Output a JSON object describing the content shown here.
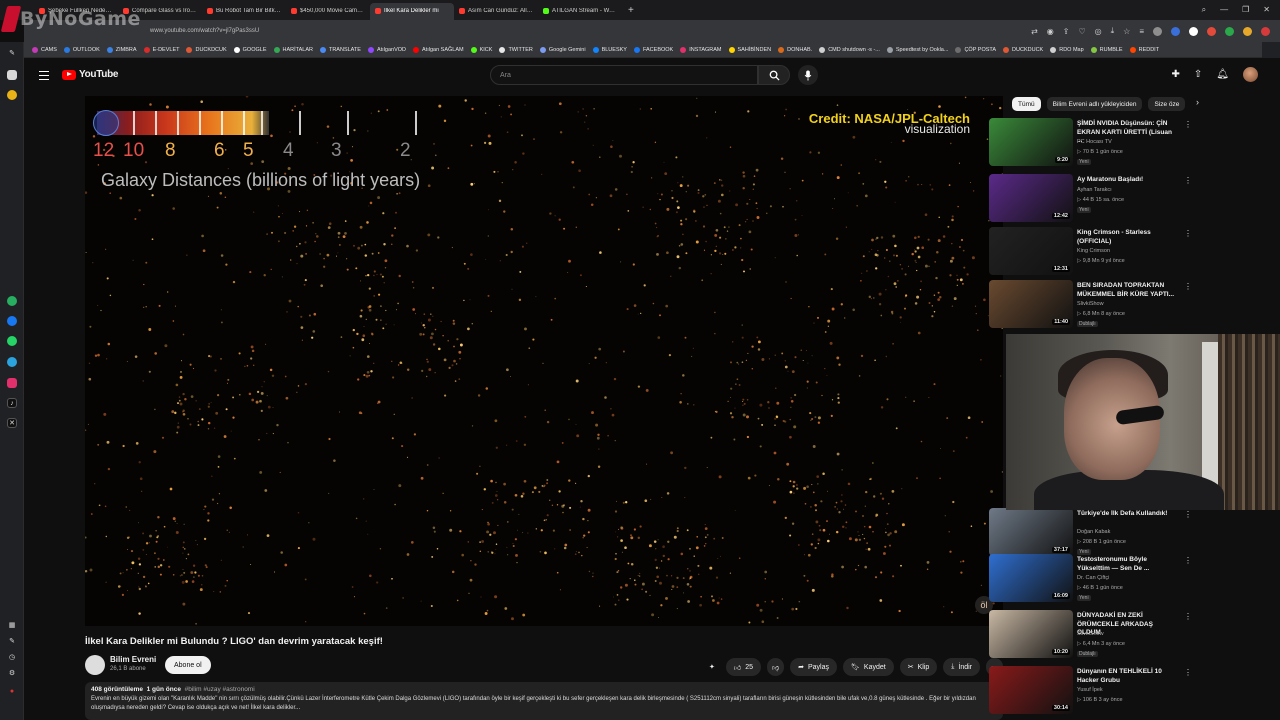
{
  "brand": {
    "overlay_text": "ByNoGame"
  },
  "browser": {
    "tabs": [
      {
        "title": "Şebeke Fullken Neden İnti",
        "active": false,
        "color": "#ff3b30"
      },
      {
        "title": "Compare Glass vs Iron - Y",
        "active": false,
        "color": "#ff3b30"
      },
      {
        "title": "Bu Robot Tam Bir Bitki Gi",
        "active": false,
        "color": "#ff3b30"
      },
      {
        "title": "$450,000 Movie Camera",
        "active": false,
        "color": "#ff3b30"
      },
      {
        "title": "İlkel Kara Delikler mi",
        "active": true,
        "color": "#ff3b30"
      },
      {
        "title": "Asım Can Gündüz: Allaşı",
        "active": false,
        "color": "#ff3b30"
      },
      {
        "title": "ATILGAN Stream - Watch",
        "active": false,
        "color": "#53fc18"
      }
    ],
    "new_tab": "+",
    "url": "www.youtube.com/watch?v=jl7gPas3ssU",
    "bookmarks": [
      {
        "label": "CAMS",
        "color": "#c53ab5"
      },
      {
        "label": "OUTLOOK",
        "color": "#2a7ae2"
      },
      {
        "label": "ZIMBRA",
        "color": "#3a82e4"
      },
      {
        "label": "E-DEVLET",
        "color": "#d92b2b"
      },
      {
        "label": "DUCKDCUK",
        "color": "#de5833"
      },
      {
        "label": "GOOGLE",
        "color": "#ffffff"
      },
      {
        "label": "HARİTALAR",
        "color": "#34a853"
      },
      {
        "label": "TRANSLATE",
        "color": "#4a8af4"
      },
      {
        "label": "AtılganVOD",
        "color": "#9147ff"
      },
      {
        "label": "Atılgan SAĞLAM",
        "color": "#ff0000"
      },
      {
        "label": "KICK",
        "color": "#53fc18"
      },
      {
        "label": "TWITTER",
        "color": "#e7e7e7"
      },
      {
        "label": "Google Gemini",
        "color": "#7b9cf0"
      },
      {
        "label": "BLUESKY",
        "color": "#1185fe"
      },
      {
        "label": "FACEBOOK",
        "color": "#1877f2"
      },
      {
        "label": "INSTAGRAM",
        "color": "#e1306c"
      },
      {
        "label": "SAHİBİNDEN",
        "color": "#ffd400"
      },
      {
        "label": "DONHAB.",
        "color": "#d96a1a"
      },
      {
        "label": "CMD shutdown -s -...",
        "color": "#cfcfcf"
      },
      {
        "label": "Speedtest by Ookla...",
        "color": "#9aa0a6"
      },
      {
        "label": "ÇÖP POSTA",
        "color": "#6d6d6d"
      },
      {
        "label": "DUCKDUCK",
        "color": "#de5833"
      },
      {
        "label": "RDO Map",
        "color": "#d0d0d0"
      },
      {
        "label": "RUMBLE",
        "color": "#85c742"
      },
      {
        "label": "REDDIT",
        "color": "#ff4500"
      }
    ]
  },
  "youtube": {
    "logo_text": "YouTube",
    "search_placeholder": "Ara",
    "video": {
      "title": "İlkel Kara Delikler mi Bulundu ? LIGO' dan devrim yaratacak keşif!",
      "overlay": {
        "scale_numbers": [
          "12",
          "10",
          "8",
          "6",
          "5",
          "4",
          "3",
          "2"
        ],
        "scale_title": "Galaxy Distances (billions of light years)",
        "credit_line1": "Credit: NASA/JPL-Caltech",
        "credit_line2": "visualization",
        "watermark": "öl"
      },
      "channel_name": "Bilim Evreni",
      "channel_subs": "26,1 B abone",
      "subscribe_label": "Abone ol",
      "like_count": "25",
      "share_label": "Paylaş",
      "save_label": "Kaydet",
      "clip_label": "Klip",
      "download_label": "İndir",
      "views": "408 görüntüleme",
      "age": "1 gün önce",
      "tags": "#bilim #uzay #astronomi",
      "description": "Evrenin en büyük gizemi  olan \"Karanlık Madde\" nin sırrı çözülmüş olabilir.Çünkü Lazer İnterferometre Kütle Çekim Dalga Gözlemevi (LIGO) tarafından öyle bir keşif gerçekleşti ki bu sefer gerçekleşen kara delik birleşmesinde ( S251112cm sinyali) tarafların birisi güneşin kütlesinden bile ufak ve,0.8 güneş kütlesinde . Eğer bir yıldızdan oluşmadıysa nereden geldi? Cevap ise oldukça açık ve net! İlkel kara delikler..."
    },
    "chips": [
      "Tümü",
      "Bilim Evreni adlı yükleyiciden",
      "Size öze"
    ],
    "recommendations": [
      {
        "title": "ŞİMDİ NVIDIA Düşünsün: ÇİN EKRAN KARTI ÜRETTİ (Lisuan ...",
        "channel": "PC Hocası TV",
        "stats": "▷ 70 B   1 gün önce",
        "badge": "Yeni",
        "duration": "9:20",
        "thumb_color": "#3a8a3a"
      },
      {
        "title": "Ay Maratonu Başladı!",
        "channel": "Ayhan Tarakcı",
        "stats": "▷ 44 B   15 sa. önce",
        "badge": "Yeni",
        "duration": "12:42",
        "thumb_color": "#5b2a8a"
      },
      {
        "title": "King Crimson - Starless (OFFICIAL)",
        "channel": "King Crimson",
        "stats": "▷ 9,8 Mn   9 yıl önce",
        "badge": "",
        "duration": "12:31",
        "thumb_color": "#222222"
      },
      {
        "title": "BEN SIRADAN TOPRAKTAN MÜKEMMEL BİR KÜRE YAPTI...",
        "channel": "SlivkiShow",
        "stats": "▷ 6,8 Mn   8 ay önce",
        "badge": "Dublajlı",
        "duration": "11:40",
        "thumb_color": "#6a4a30"
      },
      {
        "title": "Türkiye'de İlk Defa Kullandık!",
        "channel": "Doğan Kabak",
        "stats": "▷ 208 B   1 gün önce",
        "badge": "Yeni",
        "duration": "37:17",
        "thumb_color": "#6f7a88"
      },
      {
        "title": "Testosteronumu Böyle Yükselttim — Sen De ...",
        "channel": "Dr. Can Çiftçi",
        "stats": "▷ 46 B   1 gün önce",
        "badge": "Yeni",
        "duration": "16:09",
        "thumb_color": "#2f6fd1"
      },
      {
        "title": "DÜNYADAKİ EN ZEKİ ÖRÜMCEKLE ARKADAŞ OLDUM",
        "channel": "SlivkiShow",
        "stats": "▷ 6,4 Mn   3 ay önce",
        "badge": "Dublajlı",
        "duration": "10:20",
        "thumb_color": "#c9b8a4"
      },
      {
        "title": "Dünyanın EN TEHLİKELİ 10 Hacker Grubu",
        "channel": "Yusuf İpek",
        "stats": "▷ 106 B   3 ay önce",
        "badge": "",
        "duration": "30:14",
        "thumb_color": "#8a1a1a"
      }
    ]
  }
}
